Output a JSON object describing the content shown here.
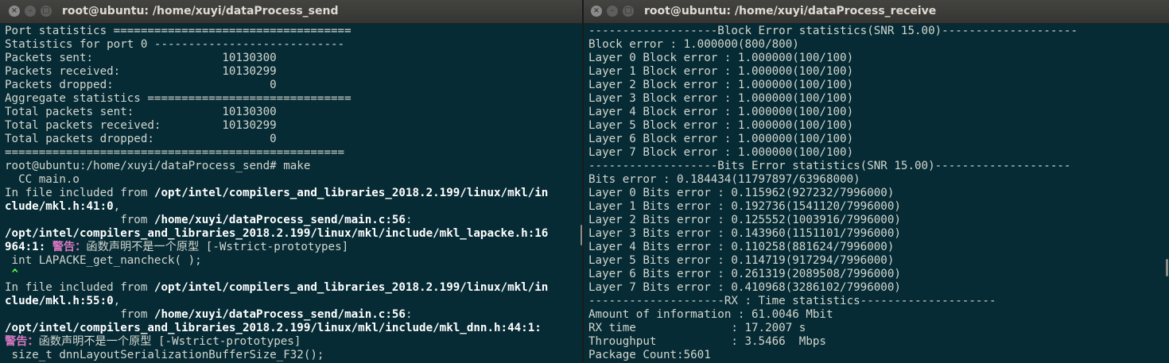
{
  "left_window": {
    "title": "root@ubuntu: /home/xuyi/dataProcess_send",
    "lines": [
      [
        [
          "Port statistics ===================================",
          ""
        ]
      ],
      [
        [
          "Statistics for port 0 ----------------------------",
          ""
        ]
      ],
      [
        [
          "Packets sent:                   10130300",
          ""
        ]
      ],
      [
        [
          "Packets received:               10130299",
          ""
        ]
      ],
      [
        [
          "Packets dropped:                       0",
          ""
        ]
      ],
      [
        [
          "Aggregate statistics ==============================",
          ""
        ]
      ],
      [
        [
          "Total packets sent:             10130300",
          ""
        ]
      ],
      [
        [
          "Total packets received:         10130299",
          ""
        ]
      ],
      [
        [
          "Total packets dropped:                 0",
          ""
        ]
      ],
      [
        [
          "==================================================",
          ""
        ]
      ],
      [
        [
          "root@ubuntu:/home/xuyi/dataProcess_send# make",
          ""
        ]
      ],
      [
        [
          "  CC main.o",
          ""
        ]
      ],
      [
        [
          "In file included from ",
          ""
        ],
        [
          "/opt/intel/compilers_and_libraries_2018.2.199/linux/mkl/in",
          "b"
        ]
      ],
      [
        [
          "clude/mkl.h:41:0",
          "b"
        ],
        [
          ",",
          ""
        ]
      ],
      [
        [
          "                 from ",
          ""
        ],
        [
          "/home/xuyi/dataProcess_send/main.c:56",
          "b"
        ],
        [
          ":",
          ""
        ]
      ],
      [
        [
          "/opt/intel/compilers_and_libraries_2018.2.199/linux/mkl/include/mkl_lapacke.h:16",
          "b"
        ]
      ],
      [
        [
          "964:1: ",
          "b"
        ],
        [
          "警告：",
          "warn"
        ],
        [
          "函数声明不是一个原型 [-Wstrict-prototypes]",
          ""
        ]
      ],
      [
        [
          " int LAPACKE_get_nancheck( );",
          ""
        ]
      ],
      [
        [
          " ^",
          "caret"
        ]
      ],
      [
        [
          "In file included from ",
          ""
        ],
        [
          "/opt/intel/compilers_and_libraries_2018.2.199/linux/mkl/in",
          "b"
        ]
      ],
      [
        [
          "clude/mkl.h:55:0",
          "b"
        ],
        [
          ",",
          ""
        ]
      ],
      [
        [
          "                 from ",
          ""
        ],
        [
          "/home/xuyi/dataProcess_send/main.c:56",
          "b"
        ],
        [
          ":",
          ""
        ]
      ],
      [
        [
          "/opt/intel/compilers_and_libraries_2018.2.199/linux/mkl/include/mkl_dnn.h:44:1:",
          "b"
        ]
      ],
      [
        [
          "警告：",
          "warn"
        ],
        [
          "函数声明不是一个原型 [-Wstrict-prototypes]",
          ""
        ]
      ],
      [
        [
          " size_t dnnLayoutSerializationBufferSize_F32();",
          ""
        ]
      ]
    ]
  },
  "right_window": {
    "title": "root@ubuntu: /home/xuyi/dataProcess_receive",
    "lines": [
      [
        [
          "-------------------Block Error statistics(SNR 15.00)--------------------",
          ""
        ]
      ],
      [
        [
          "Block error : 1.000000(800/800)",
          ""
        ]
      ],
      [
        [
          "Layer 0 Block error : 1.000000(100/100)",
          ""
        ]
      ],
      [
        [
          "Layer 1 Block error : 1.000000(100/100)",
          ""
        ]
      ],
      [
        [
          "Layer 2 Block error : 1.000000(100/100)",
          ""
        ]
      ],
      [
        [
          "Layer 3 Block error : 1.000000(100/100)",
          ""
        ]
      ],
      [
        [
          "Layer 4 Block error : 1.000000(100/100)",
          ""
        ]
      ],
      [
        [
          "Layer 5 Block error : 1.000000(100/100)",
          ""
        ]
      ],
      [
        [
          "Layer 6 Block error : 1.000000(100/100)",
          ""
        ]
      ],
      [
        [
          "Layer 7 Block error : 1.000000(100/100)",
          ""
        ]
      ],
      [
        [
          "-------------------Bits Error statistics(SNR 15.00)--------------------",
          ""
        ]
      ],
      [
        [
          "Bits error : 0.184434(11797897/63968000)",
          ""
        ]
      ],
      [
        [
          "Layer 0 Bits error : 0.115962(927232/7996000)",
          ""
        ]
      ],
      [
        [
          "Layer 1 Bits error : 0.192736(1541120/7996000)",
          ""
        ]
      ],
      [
        [
          "Layer 2 Bits error : 0.125552(1003916/7996000)",
          ""
        ]
      ],
      [
        [
          "Layer 3 Bits error : 0.143960(1151101/7996000)",
          ""
        ]
      ],
      [
        [
          "Layer 4 Bits error : 0.110258(881624/7996000)",
          ""
        ]
      ],
      [
        [
          "Layer 5 Bits error : 0.114719(917294/7996000)",
          ""
        ]
      ],
      [
        [
          "Layer 6 Bits error : 0.261319(2089508/7996000)",
          ""
        ]
      ],
      [
        [
          "Layer 7 Bits error : 0.410968(3286102/7996000)",
          ""
        ]
      ],
      [
        [
          "--------------------RX : Time statistics--------------------",
          ""
        ]
      ],
      [
        [
          "Amount of information : 61.0046 Mbit",
          ""
        ]
      ],
      [
        [
          "RX time              : 17.2007 s",
          ""
        ]
      ],
      [
        [
          "Throughput           : 3.5466  Mbps",
          ""
        ]
      ],
      [
        [
          "Package Count:5601",
          ""
        ]
      ]
    ]
  },
  "window_controls": {
    "close": "×",
    "minimize": "–",
    "maximize": "□"
  },
  "colors": {
    "terminal_background": "#062b35",
    "terminal_text": "#d3d7cf",
    "bold_text": "#ffffff",
    "warning_text": "#d978c2",
    "caret_text": "#5cff4a",
    "titlebar": "#3c3c3a"
  },
  "icons": [
    "close-icon",
    "minimize-icon",
    "maximize-icon"
  ]
}
